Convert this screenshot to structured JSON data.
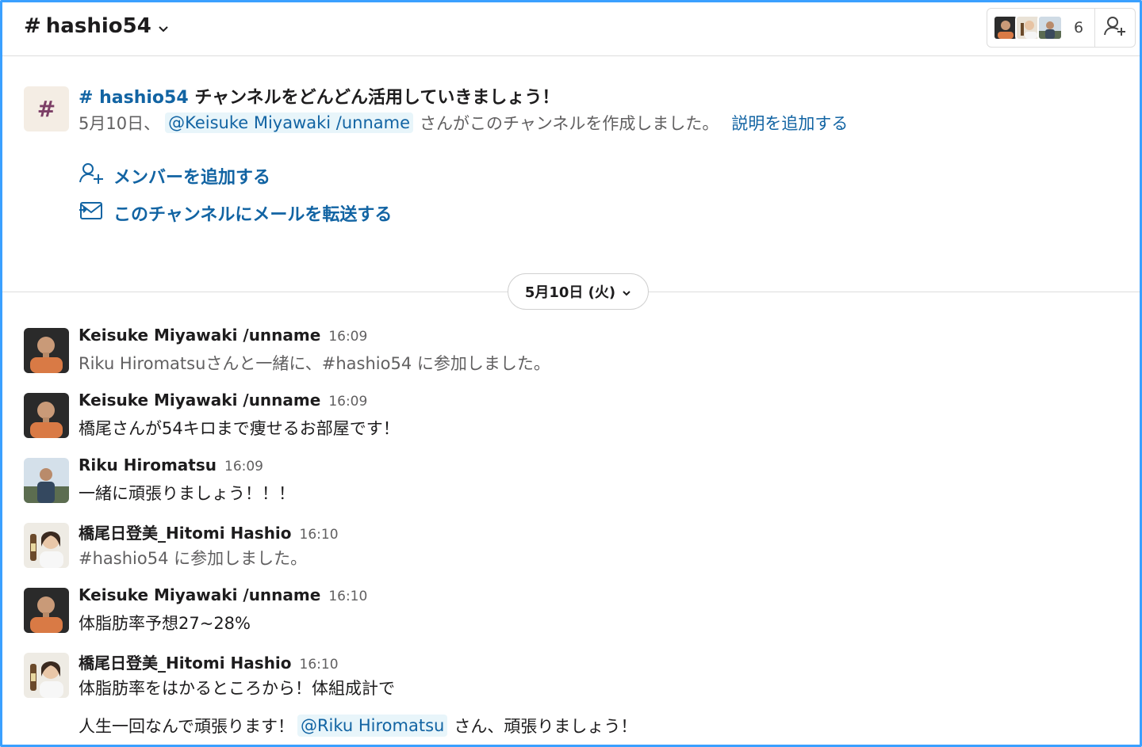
{
  "header": {
    "hash": "#",
    "channel_name": "hashio54",
    "member_count": "6"
  },
  "intro": {
    "title_hash": "#",
    "title_channel": "hashio54",
    "title_rest": " チャンネルをどんどん活用していきましょう！",
    "created_date": "5月10日、",
    "creator_mention": "@Keisuke Miyawaki /unname",
    "created_text": "さんがこのチャンネルを作成しました。",
    "add_description": "説明を追加する",
    "add_members": "メンバーを追加する",
    "forward_email": "このチャンネルにメールを転送する"
  },
  "date_divider": {
    "label": "5月10日 (火)"
  },
  "messages": [
    {
      "name": "Keisuke Miyawaki /unname",
      "time": "16:09",
      "text": "Riku Hiromatsuさんと一緒に、#hashio54 に参加しました。"
    },
    {
      "name": "Keisuke Miyawaki /unname",
      "time": "16:09",
      "text": "橋尾さんが54キロまで痩せるお部屋です！"
    },
    {
      "name": "Riku Hiromatsu",
      "time": "16:09",
      "text": "一緒に頑張りましょう！！！"
    },
    {
      "name": "橋尾日登美_Hitomi Hashio",
      "time": "16:10",
      "text": "#hashio54 に参加しました。"
    },
    {
      "name": "Keisuke Miyawaki /unname",
      "time": "16:10",
      "text": "体脂肪率予想27~28%"
    },
    {
      "name": "橋尾日登美_Hitomi Hashio",
      "time": "16:10",
      "text": "体脂肪率をはかるところから！体組成計で",
      "line2_before": "人生一回なんで頑張ります！",
      "line2_mention": "@Riku Hiromatsu",
      "line2_after": "さん、頑張りましょう！"
    }
  ],
  "colors": {
    "link": "#1264a3",
    "border_accent": "#3aa0ff",
    "mention_bg": "#e8f5fa",
    "intro_icon_bg": "#f4ede4"
  }
}
